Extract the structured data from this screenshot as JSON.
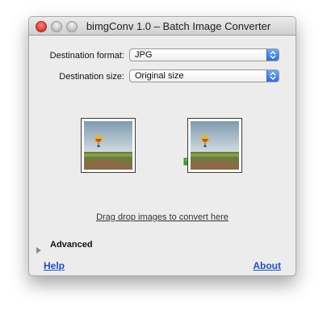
{
  "window": {
    "title": "bimgConv 1.0 – Batch Image Converter"
  },
  "format": {
    "label": "Destination format:",
    "value": "JPG"
  },
  "size": {
    "label": "Destination size:",
    "value": "Original size"
  },
  "icons": {
    "source": "balloon-photo-icon",
    "arrow": "green-arrow-icon",
    "target": "balloon-photo-icon"
  },
  "drop_hint": "Drag drop images to convert here",
  "advanced": {
    "label": "Advanced"
  },
  "footer": {
    "help": "Help",
    "about": "About"
  },
  "colors": {
    "link": "#1d4fd1",
    "arrow": "#3aa829"
  }
}
